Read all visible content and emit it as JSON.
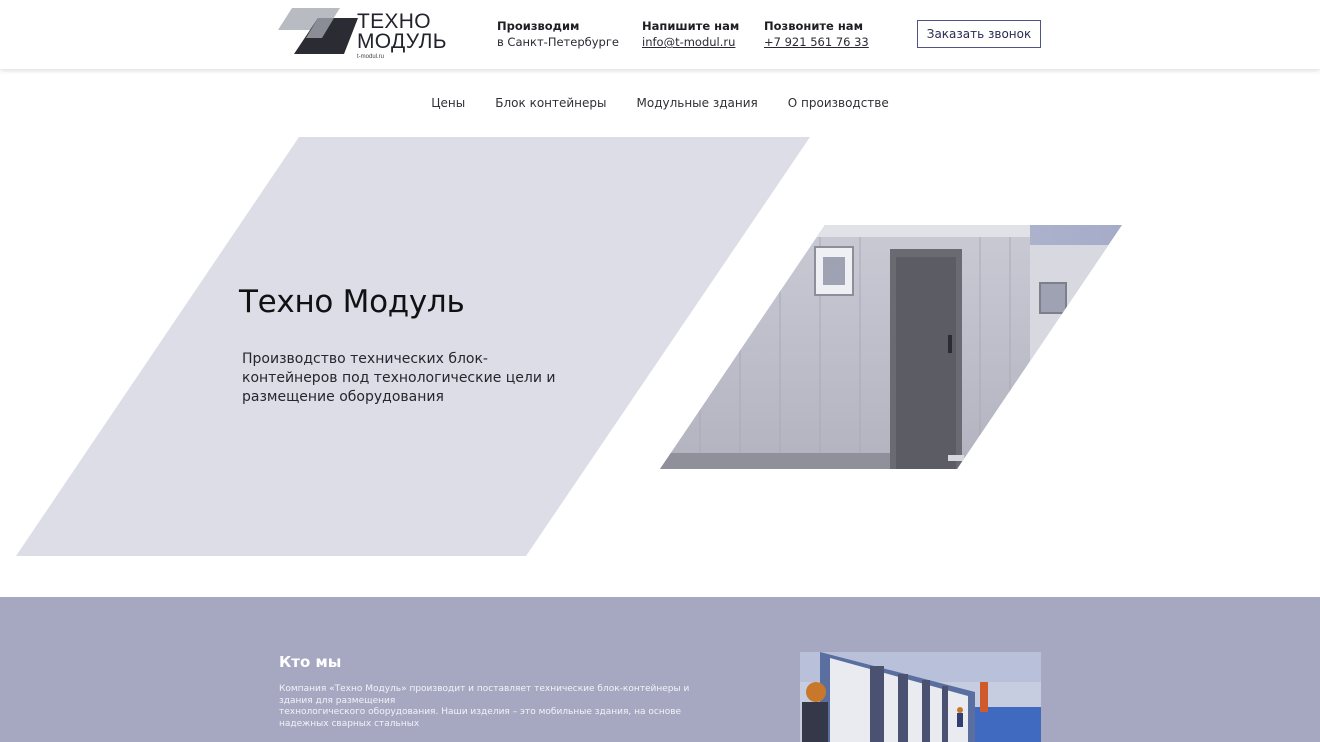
{
  "header": {
    "logo": {
      "line1": "ТЕХНО",
      "line2": "МОДУЛЬ",
      "sub": "t-modul.ru"
    },
    "produce": {
      "title": "Производим",
      "value": "в Санкт-Петербурге"
    },
    "write": {
      "title": "Напишите нам",
      "value": "info@t-modul.ru"
    },
    "call": {
      "title": "Позвоните нам",
      "value": "+7 921 561 76 33"
    },
    "callback_button": "Заказать звонок"
  },
  "nav": {
    "items": [
      "Цены",
      "Блок контейнеры",
      "Модульные здания",
      "О производстве"
    ]
  },
  "hero": {
    "title": "Техно Модуль",
    "description": "Производство технических блок-контейнеров под технологические цели и размещение оборудования"
  },
  "about": {
    "title": "Кто мы",
    "text_line1": "Компания «Техно Модуль» производит и поставляет технические блок-контейнеры и",
    "text_line2": "здания для размещения",
    "text_line3": "технологического оборудования. Наши изделия – это мобильные здания, на основе",
    "text_line4": "надежных сварных стальных"
  },
  "colors": {
    "hero_shape": "#dcdde6",
    "about_bg": "#a6a8c2",
    "button_border": "#50528a"
  }
}
